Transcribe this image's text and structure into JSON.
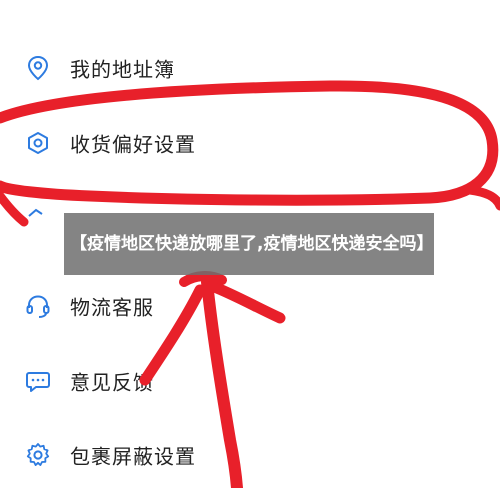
{
  "menu": {
    "items": [
      {
        "label": "我的地址簿",
        "icon": "location-pin-icon"
      },
      {
        "label": "收货偏好设置",
        "icon": "hexagon-settings-icon"
      },
      {
        "label": "",
        "icon": "partial-icon"
      },
      {
        "label": "物流客服",
        "icon": "headset-icon"
      },
      {
        "label": "意见反馈",
        "icon": "chat-bubble-icon"
      },
      {
        "label": "包裹屏蔽设置",
        "icon": "gear-icon"
      }
    ]
  },
  "overlay": {
    "caption": "【疫情地区快递放哪里了,疫情地区快递安全吗】"
  },
  "colors": {
    "icon": "#2d7be0",
    "annotation": "#e8202a"
  }
}
